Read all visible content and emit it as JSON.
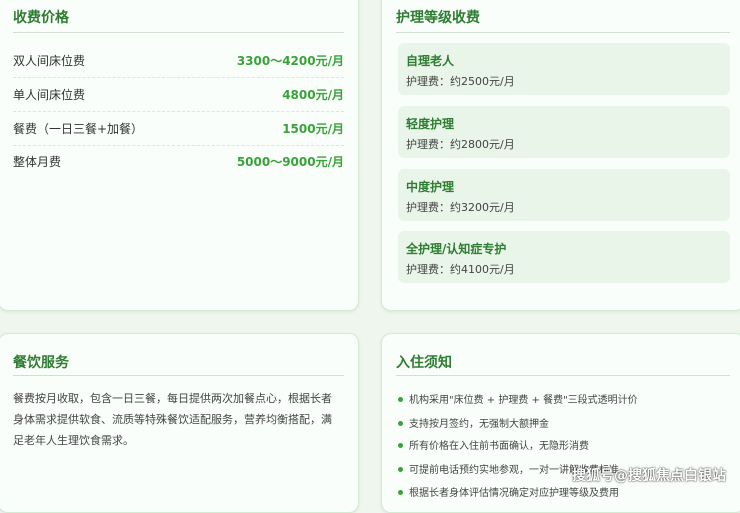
{
  "fees": {
    "title": "收费价格",
    "rows": [
      {
        "label": "双人间床位费",
        "value": "3300～4200元/月"
      },
      {
        "label": "单人间床位费",
        "value": "4800元/月"
      },
      {
        "label": "餐费（一日三餐+加餐）",
        "value": "1500元/月"
      },
      {
        "label": "整体月费",
        "value": "5000～9000元/月"
      }
    ]
  },
  "care_levels": {
    "title": "护理等级收费",
    "items": [
      {
        "name": "自理老人",
        "fee": "护理费：约2500元/月"
      },
      {
        "name": "轻度护理",
        "fee": "护理费：约2800元/月"
      },
      {
        "name": "中度护理",
        "fee": "护理费：约3200元/月"
      },
      {
        "name": "全护理/认知症专护",
        "fee": "护理费：约4100元/月"
      }
    ]
  },
  "dining": {
    "title": "餐饮服务",
    "text": "餐费按月收取，包含一日三餐，每日提供两次加餐点心，根据长者身体需求提供软食、流质等特殊餐饮适配服务，营养均衡搭配，满足老年人生理饮食需求。"
  },
  "notice": {
    "title": "入住须知",
    "items": [
      "机构采用\"床位费 + 护理费 + 餐费\"三段式透明计价",
      "支持按月签约，无强制大额押金",
      "所有价格在入住前书面确认，无隐形消费",
      "可提前电话预约实地参观，一对一讲解收费标准",
      "根据长者身体评估情况确定对应护理等级及费用"
    ]
  },
  "watermark": "搜狐号@搜狐焦点白银站",
  "colors": {
    "accent": "#2e7d32",
    "price": "#3aa23a",
    "level_bg": "#e8f5e8"
  }
}
